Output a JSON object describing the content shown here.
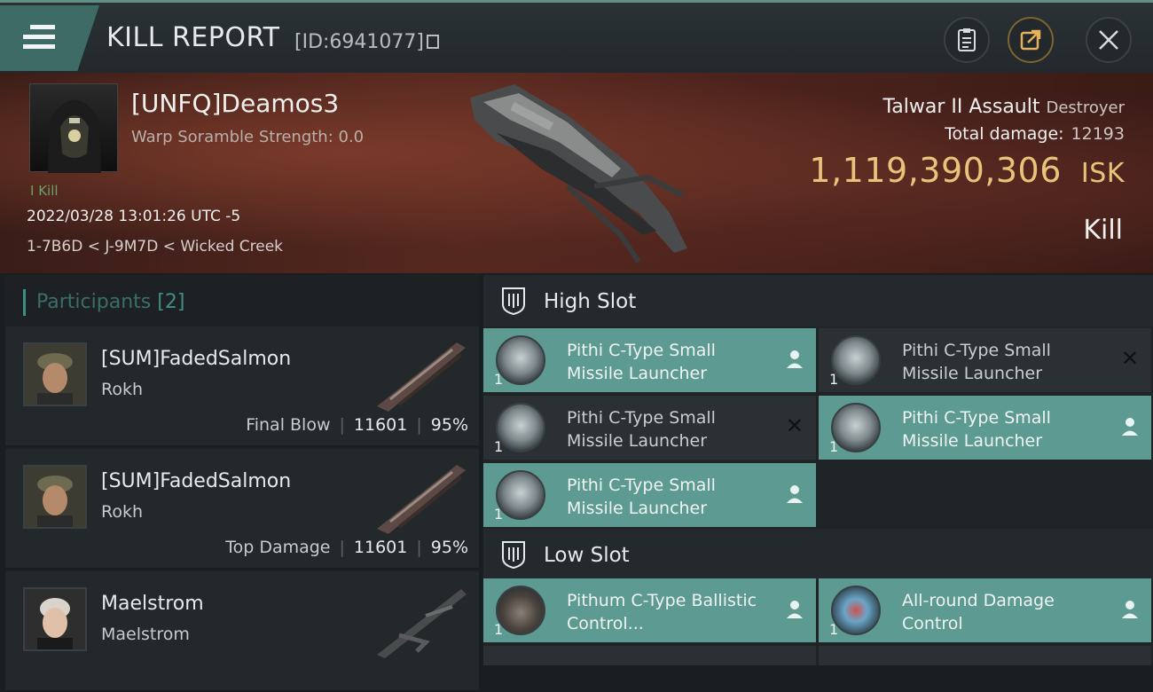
{
  "header": {
    "title": "KILL REPORT",
    "kill_id": "[ID:6941077]"
  },
  "victim": {
    "name": "[UNFQ]Deamos3",
    "warp_scramble": "Warp Soramble Strength: 0.0",
    "kill_tag": "I Kill",
    "date": "2022/03/28 13:01:26 UTC -5",
    "location": "1-7B6D < J-9M7D < Wicked Creek",
    "ship_name": "Talwar II Assault",
    "ship_class": "Destroyer",
    "total_damage_label": "Total damage:",
    "total_damage": "12193",
    "isk_value": "1,119,390,306",
    "isk_unit": "ISK",
    "result": "Kill"
  },
  "participants": {
    "label": "Participants",
    "count": "[2]",
    "items": [
      {
        "name": "[SUM]FadedSalmon",
        "ship": "Rokh",
        "role": "Final Blow",
        "damage": "11601",
        "percent": "95%"
      },
      {
        "name": "[SUM]FadedSalmon",
        "ship": "Rokh",
        "role": "Top Damage",
        "damage": "11601",
        "percent": "95%"
      },
      {
        "name": "Maelstrom",
        "ship": "Maelstrom"
      }
    ]
  },
  "fitting": {
    "high_slot_label": "High Slot",
    "low_slot_label": "Low Slot",
    "high": [
      {
        "name": "Pithi C-Type Small Missile Launcher",
        "qty": "1",
        "status": "dropped"
      },
      {
        "name": "Pithi C-Type Small Missile Launcher",
        "qty": "1",
        "status": "destroyed"
      },
      {
        "name": "Pithi C-Type Small Missile Launcher",
        "qty": "1",
        "status": "destroyed"
      },
      {
        "name": "Pithi C-Type Small Missile Launcher",
        "qty": "1",
        "status": "dropped"
      },
      {
        "name": "Pithi C-Type Small Missile Launcher",
        "qty": "1",
        "status": "dropped"
      }
    ],
    "low": [
      {
        "name": "Pithum C-Type Ballistic Control...",
        "qty": "1",
        "status": "dropped"
      },
      {
        "name": "All-round Damage Control",
        "qty": "1",
        "status": "dropped"
      }
    ]
  },
  "colors": {
    "accent": "#5c9a92",
    "isk": "#e9c37a"
  }
}
